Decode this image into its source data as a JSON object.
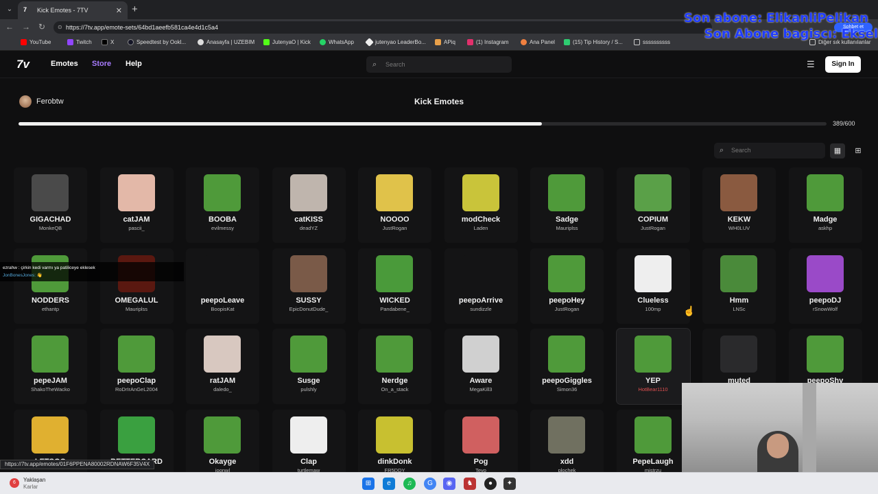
{
  "browser": {
    "tab_title": "Kick Emotes - 7TV",
    "url": "https://7tv.app/emote-sets/64bd1aeefb581ca4e4d1c5a4",
    "bookmarks": [
      "YouTube",
      "Twitch",
      "X",
      "Speedtest by Ookl...",
      "Anasayfa | UZEBIM",
      "JutenyaO | Kick",
      "WhatsApp",
      "jutenyao LeaderBo...",
      "APiq",
      "(1) Instagram",
      "Ana Panel",
      "(15) Tip History / S...",
      "ssssssssss"
    ],
    "bookmarks_other": "Diğer sık kullanılanlar",
    "profile_btn": "Sohbet et"
  },
  "stream_overlay": {
    "line1": "Son abone: ElikanliPelikan",
    "line2": "Son Abone bagiscı: Eksel"
  },
  "site": {
    "logo": "7v",
    "nav": [
      "Emotes",
      "Store",
      "Help"
    ],
    "search_placeholder": "Search",
    "signin": "Sign In"
  },
  "set": {
    "owner": "Ferobtw",
    "title": "Kick Emotes",
    "count_label": "389/600",
    "progress_fraction": 0.648,
    "search_placeholder": "Search"
  },
  "emotes": [
    {
      "name": "GIGACHAD",
      "owner": "MonkeQB",
      "color": "#4a4a4a"
    },
    {
      "name": "catJAM",
      "owner": "pascii_",
      "color": "#e3b8a8"
    },
    {
      "name": "BOOBA",
      "owner": "evilmessy",
      "color": "#4f9a3a"
    },
    {
      "name": "catKISS",
      "owner": "deadYZ",
      "color": "#bfb5ad"
    },
    {
      "name": "NOOOO",
      "owner": "JustRogan",
      "color": "#e0c24a"
    },
    {
      "name": "modCheck",
      "owner": "Laden",
      "color": "#c9c43a"
    },
    {
      "name": "Sadge",
      "owner": "Mauriplss",
      "color": "#4f9a3a"
    },
    {
      "name": "COPIUM",
      "owner": "JustRogan",
      "color": "#5aa048"
    },
    {
      "name": "KEKW",
      "owner": "WH0LUV",
      "color": "#8a5a40"
    },
    {
      "name": "Madge",
      "owner": "askhp",
      "color": "#4f9a3a"
    },
    {
      "name": "NODDERS",
      "owner": "ethantp",
      "color": "#4f9a3a"
    },
    {
      "name": "OMEGALUL",
      "owner": "Mauriplss",
      "color": "#5a1810"
    },
    {
      "name": "peepoLeave",
      "owner": "BoopisKat",
      "color": "#141415"
    },
    {
      "name": "SUSSY",
      "owner": "EpicDonutDude_",
      "color": "#7a5a48"
    },
    {
      "name": "WICKED",
      "owner": "Pandabene_",
      "color": "#4a9a3a"
    },
    {
      "name": "peepoArrive",
      "owner": "sundizzle",
      "color": "#141415"
    },
    {
      "name": "peepoHey",
      "owner": "JustRogan",
      "color": "#4f9a3a"
    },
    {
      "name": "Clueless",
      "owner": "100mp",
      "color": "#eeeeee"
    },
    {
      "name": "Hmm",
      "owner": "LNSc",
      "color": "#4a8a3a"
    },
    {
      "name": "peepoDJ",
      "owner": "rSnowWolf",
      "color": "#9a4ac8"
    },
    {
      "name": "pepeJAM",
      "owner": "ShakoTheWacko",
      "color": "#4f9a3a"
    },
    {
      "name": "peepoClap",
      "owner": "RoDrIrAnGeL2004",
      "color": "#4f9a3a"
    },
    {
      "name": "ratJAM",
      "owner": "daledo_",
      "color": "#d8c8c0"
    },
    {
      "name": "Susge",
      "owner": "pulshly",
      "color": "#4f9a3a"
    },
    {
      "name": "Nerdge",
      "owner": "On_a_stack",
      "color": "#4f9a3a"
    },
    {
      "name": "Aware",
      "owner": "MegaKill3",
      "color": "#d0d0d0"
    },
    {
      "name": "peepoGiggles",
      "owner": "Simon36",
      "color": "#4f9a3a"
    },
    {
      "name": "YEP",
      "owner": "HotBear1110",
      "color": "#4f9a3a"
    },
    {
      "name": "muted",
      "owner": "",
      "color": "#2a2a2c"
    },
    {
      "name": "peepoShy",
      "owner": "",
      "color": "#4f9a3a"
    },
    {
      "name": "LETSGO",
      "owner": "",
      "color": "#e0b030"
    },
    {
      "name": "BETTERCARD",
      "owner": "",
      "color": "#3aa040"
    },
    {
      "name": "Okayge",
      "owner": "joonwl",
      "color": "#4f9a3a"
    },
    {
      "name": "Clap",
      "owner": "turtlemaw",
      "color": "#eeeeee"
    },
    {
      "name": "dinkDonk",
      "owner": "FR5DDY",
      "color": "#c8c030"
    },
    {
      "name": "Pog",
      "owner": "Teyo",
      "color": "#d06060"
    },
    {
      "name": "xdd",
      "owner": "plochek",
      "color": "#707060"
    },
    {
      "name": "PepeLaugh",
      "owner": "mistrzu",
      "color": "#4f9a3a"
    }
  ],
  "chat_overlay": {
    "line1": "ezrahw : çirkin kedi varmı ya patiliceye eklesek",
    "line2": "JonBonesJones: 👋"
  },
  "status_url": "https://7tv.app/emotes/01F6PPENA80002RDNAW6F35V4X",
  "taskbar": {
    "weather_title": "Yaklaşan",
    "weather_sub": "Karlar",
    "badge": "6"
  }
}
